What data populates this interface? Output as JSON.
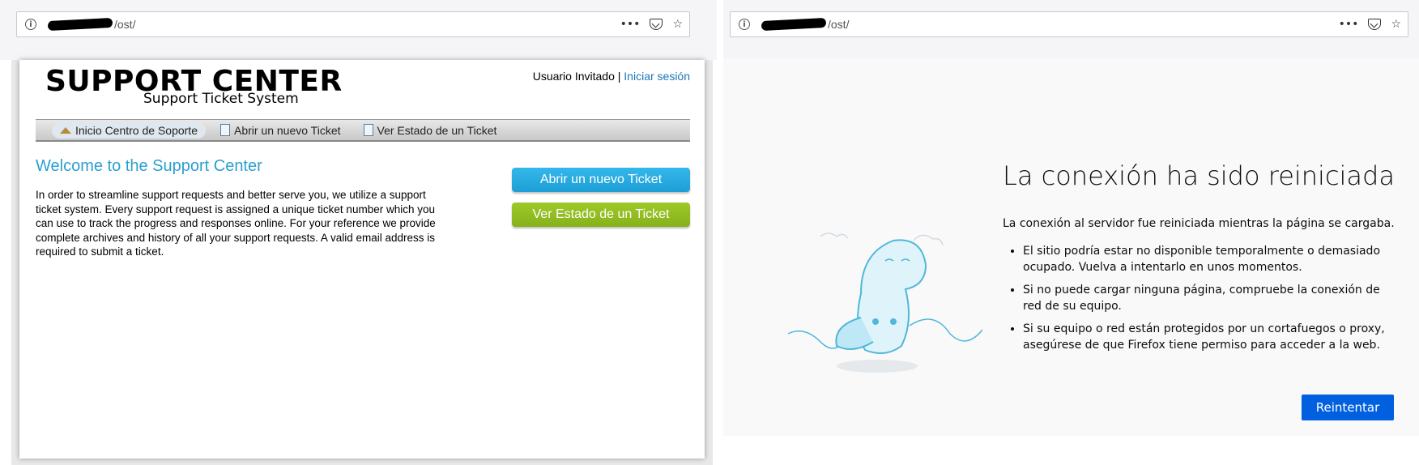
{
  "left_window": {
    "url_path": "/ost/",
    "logo": {
      "title": "SUPPORT CENTER",
      "subtitle": "Support Ticket System"
    },
    "user": {
      "guest_label": "Usuario Invitado",
      "separator": "|",
      "login_link": "Iniciar sesión"
    },
    "nav": [
      {
        "label": "Inicio Centro de Soporte",
        "icon": "home-icon",
        "active": true
      },
      {
        "label": "Abrir un nuevo Ticket",
        "icon": "new-ticket-icon",
        "active": false
      },
      {
        "label": "Ver Estado de un Ticket",
        "icon": "ticket-status-icon",
        "active": false
      }
    ],
    "welcome_title": "Welcome to the Support Center",
    "intro_text": "In order to streamline support requests and better serve you, we utilize a support ticket system. Every support request is assigned a unique ticket number which you can use to track the progress and responses online. For your reference we provide complete archives and history of all your support requests. A valid email address is required to submit a ticket.",
    "buttons": {
      "open_ticket": "Abrir un nuevo Ticket",
      "check_status": "Ver Estado de un Ticket"
    },
    "colors": {
      "accent_blue": "#1d9fd6",
      "accent_green": "#85b21a",
      "link": "#1a77b5"
    }
  },
  "right_window": {
    "url_path": "/ost/",
    "error_title": "La conexión ha sido reiniciada",
    "error_description": "La conexión al servidor fue reiniciada mientras la página se cargaba.",
    "suggestions": [
      "El sitio podría estar no disponible temporalmente o demasiado ocupado. Vuelva a intentarlo en unos momentos.",
      "Si no puede cargar ninguna página, compruebe la conexión de red de su equipo.",
      "Si su equipo o red están protegidos por un cortafuegos o proxy, asegúrese de que Firefox tiene permiso para acceder a la web."
    ],
    "retry_button": "Reintentar",
    "colors": {
      "primary_button": "#0060df",
      "illustration": "#4fb8d8"
    }
  },
  "toolbar_icons": [
    "info-icon",
    "more-icon",
    "pocket-icon",
    "bookmark-star-icon"
  ]
}
